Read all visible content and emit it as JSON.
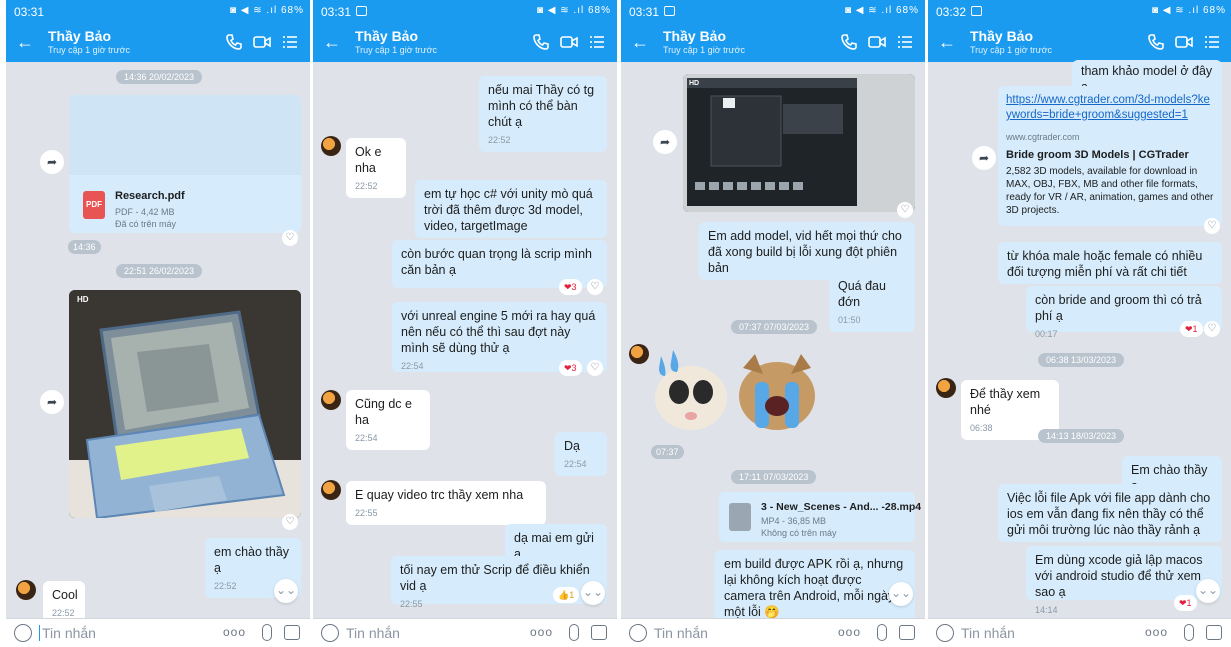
{
  "common": {
    "contact_name": "Thầy Bảo",
    "contact_status": "Truy cập 1 giờ trước",
    "input_placeholder": "Tin nhắn",
    "status_icons": "◙ ◀ ≋ .ıl 68%",
    "more_glyph": "ooo",
    "share_glyph": "➦",
    "heart_glyph": "♡",
    "down_glyph": "⌄⌄",
    "back_glyph": "←"
  },
  "screen1": {
    "time": "03:31",
    "date_pill_1": "14:36 20/02/2023",
    "file_name": "Research.pdf",
    "file_meta": "PDF - 4,42 MB",
    "file_status": "Đã có trên máy",
    "file_icon_label": "PDF",
    "time_pill": "14:36",
    "date_pill_2": "22:51 26/02/2023",
    "hd_label": "HD",
    "msg_1": "em chào thầy ạ",
    "msg_1_time": "22:52",
    "msg_2": "Cool",
    "msg_2_time": "22:52"
  },
  "screen2": {
    "time": "03:31",
    "m1": "nếu mai Thầy có tg mình có thể bàn chút ạ",
    "m1_time": "22:52",
    "m2": "Ok e nha",
    "m2_time": "22:52",
    "m3": "em tự học c# với unity mò quá trời đã thêm được 3d model, video, targetImage",
    "m4": "còn bước quan trọng là scrip mình căn bản ạ",
    "m4_react": "❤3",
    "m5": "với unreal engine 5 mới ra hay quá nên nếu có thể thì sau đợt này mình sẽ dùng thử ạ",
    "m5_time": "22:54",
    "m5_react": "❤3",
    "m6": "Cũng dc e ha",
    "m6_time": "22:54",
    "m7": "Dạ",
    "m7_time": "22:54",
    "m8": "E quay video trc thầy xem nha",
    "m8_time": "22:55",
    "m9": "dạ mai em gửi ạ",
    "m10": "tối nay em thử Scrip để điều khiển vid ạ",
    "m10_time": "22:55",
    "m10_react": "👍1"
  },
  "screen3": {
    "time": "03:31",
    "hd_label": "HD",
    "m1": "Em add model, vid hết mọi thứ cho đã xong build bị lỗi xung đột phiên bản",
    "m2": "Quá đau đớn",
    "m2_time": "01:50",
    "date_pill_1": "07:37 07/03/2023",
    "sticker_time": "07:37",
    "date_pill_2": "17:11 07/03/2023",
    "video_name": "3 - New_Scenes - And... -28.mp4",
    "video_meta": "MP4 - 36,85 MB",
    "video_status": "Không có trên máy",
    "m3": "em build được APK rồi ạ, nhưng lại không kích hoạt được camera trên Android, mỗi ngày một lỗi 🤭"
  },
  "screen4": {
    "time": "03:32",
    "m0": "tham khảo model ở đây ạ",
    "link_url": "https://www.cgtrader.com/3d-models?keywords=bride+groom&suggested=1",
    "card_domain": "www.cgtrader.com",
    "card_title": "Bride groom 3D Models | CGTrader",
    "card_desc": "2,582 3D models, available for download in MAX, OBJ, FBX, MB and other file formats, ready for VR / AR, animation, games and other 3D projects.",
    "m1": "từ khóa male hoặc female có nhiều đối tượng miễn phí và rất chi tiết",
    "m2": "còn bride and groom thì có trả phí ạ",
    "m2_time": "00:17",
    "m2_react": "❤1",
    "date_pill_1": "06:38 13/03/2023",
    "m3": "Để thầy xem nhé",
    "m3_time": "06:38",
    "date_pill_2": "14:13 18/03/2023",
    "m4": "Em chào thầy ạ",
    "m5": "Việc lỗi file Apk với file app dành cho ios em vẫn đang fix nên thầy có thể gửi môi trường lúc nào thầy rảnh ạ",
    "m6": "Em dùng xcode giả lập macos với android studio để thử xem sao ạ",
    "m6_time": "14:14",
    "m6_react": "❤1"
  }
}
